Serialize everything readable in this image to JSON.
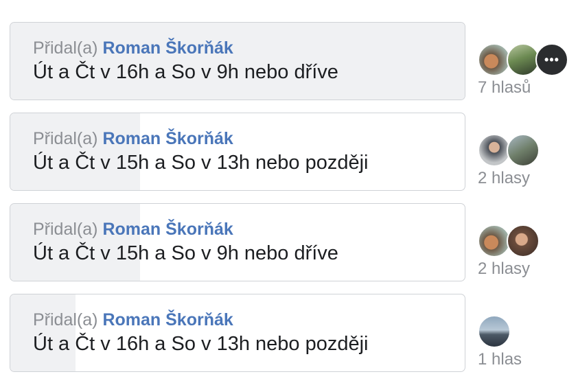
{
  "poll": {
    "options": [
      {
        "added_by_prefix": "Přidal(a)",
        "author": "Roman Škorňák",
        "label": "Út a Čt v 16h a So v 9h nebo dříve",
        "votes": 7,
        "vote_label": "7 hlasů",
        "vote_share": 1.0,
        "avatars": [
          "voter-avatar-1",
          "voter-avatar-2",
          "more-voters-avatar"
        ]
      },
      {
        "added_by_prefix": "Přidal(a)",
        "author": "Roman Škorňák",
        "label": "Út a Čt v 15h a So v 13h nebo později",
        "votes": 2,
        "vote_label": "2 hlasy",
        "vote_share": 0.286,
        "avatars": [
          "voter-avatar-1",
          "voter-avatar-2"
        ]
      },
      {
        "added_by_prefix": "Přidal(a)",
        "author": "Roman Škorňák",
        "label": "Út a Čt v 15h a So v 9h nebo dříve",
        "votes": 2,
        "vote_label": "2 hlasy",
        "vote_share": 0.286,
        "avatars": [
          "voter-avatar-1",
          "voter-avatar-2"
        ]
      },
      {
        "added_by_prefix": "Přidal(a)",
        "author": "Roman Škorňák",
        "label": "Út a Čt v 16h a So v 13h nebo později",
        "votes": 1,
        "vote_label": "1 hlas",
        "vote_share": 0.143,
        "avatars": [
          "voter-avatar-1"
        ]
      }
    ]
  },
  "colors": {
    "author_link": "#4a76b9",
    "muted_text": "#8b8e93",
    "label_text": "#1c1e21",
    "fill": "#f0f1f3",
    "border": "#cfd2d6"
  }
}
